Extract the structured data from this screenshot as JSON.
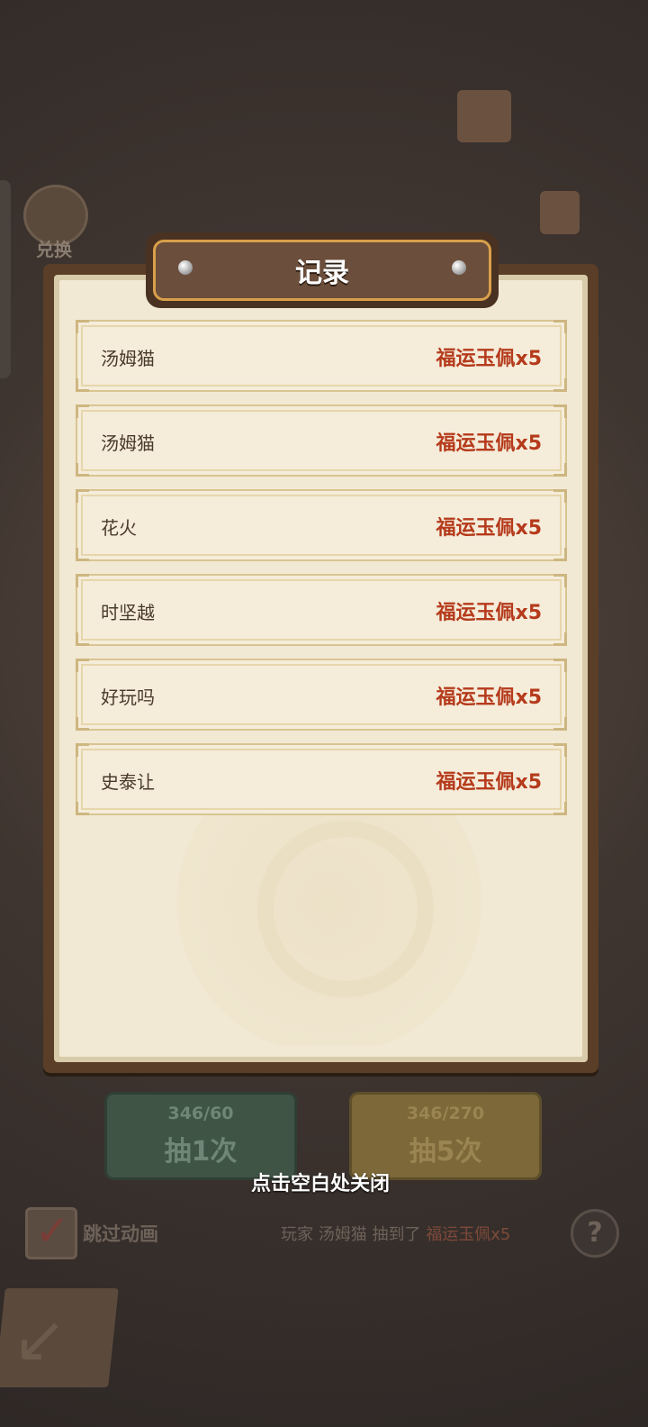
{
  "background": {
    "exchange_label": "兑换",
    "buttons": [
      {
        "cost": "346/60",
        "action": "抽1次"
      },
      {
        "cost": "346/270",
        "action": "抽5次"
      }
    ],
    "skip_label": "跳过动画",
    "ticker": {
      "prefix": "玩家",
      "player": "汤姆猫",
      "verb": "抽到了",
      "item": "福运玉佩x5"
    },
    "help_glyph": "?"
  },
  "dialog": {
    "title": "记录",
    "records": [
      {
        "player": "汤姆猫",
        "reward": "福运玉佩x5"
      },
      {
        "player": "汤姆猫",
        "reward": "福运玉佩x5"
      },
      {
        "player": "花火",
        "reward": "福运玉佩x5"
      },
      {
        "player": "时坚越",
        "reward": "福运玉佩x5"
      },
      {
        "player": "好玩吗",
        "reward": "福运玉佩x5"
      },
      {
        "player": "史泰让",
        "reward": "福运玉佩x5"
      }
    ],
    "close_hint": "点击空白处关闭"
  },
  "colors": {
    "reward_text": "#b53a1b",
    "title_plate_border": "#d99f4a",
    "panel_frame": "#5b3e27",
    "paper": "#f2e9d4"
  }
}
